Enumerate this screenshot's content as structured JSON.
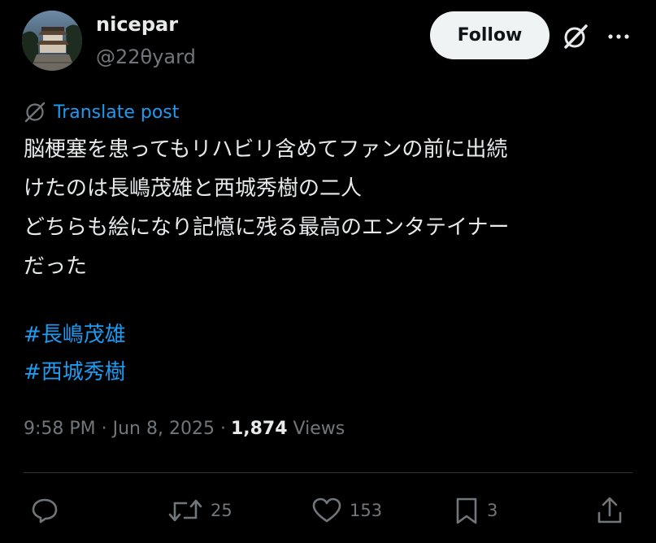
{
  "author": {
    "name": "nicepar",
    "handle": "@22θyard"
  },
  "follow_label": "Follow",
  "icons": {
    "grok": "grok-icon",
    "more": "more-icon",
    "translate": "globe-slash-icon"
  },
  "translate_label": "Translate post",
  "body_lines": [
    "脳梗塞を患ってもリハビリ含めてファンの前に出続",
    "けたのは長嶋茂雄と西城秀樹の二人",
    "どちらも絵になり記憶に残る最高のエンタテイナー",
    "だった"
  ],
  "hashtags": [
    "#長嶋茂雄",
    "#西城秀樹"
  ],
  "meta": {
    "timestamp": "9:58 PM · Jun 8, 2025 · ",
    "views_count": "1,874",
    "views_label": "Views"
  },
  "actions": {
    "reply_count": "",
    "repost_count": "25",
    "like_count": "153",
    "bookmark_count": "3"
  },
  "colors": {
    "accent": "#1d9bf0",
    "text": "#e7e9ea",
    "muted": "#71767b",
    "background": "#000000"
  }
}
